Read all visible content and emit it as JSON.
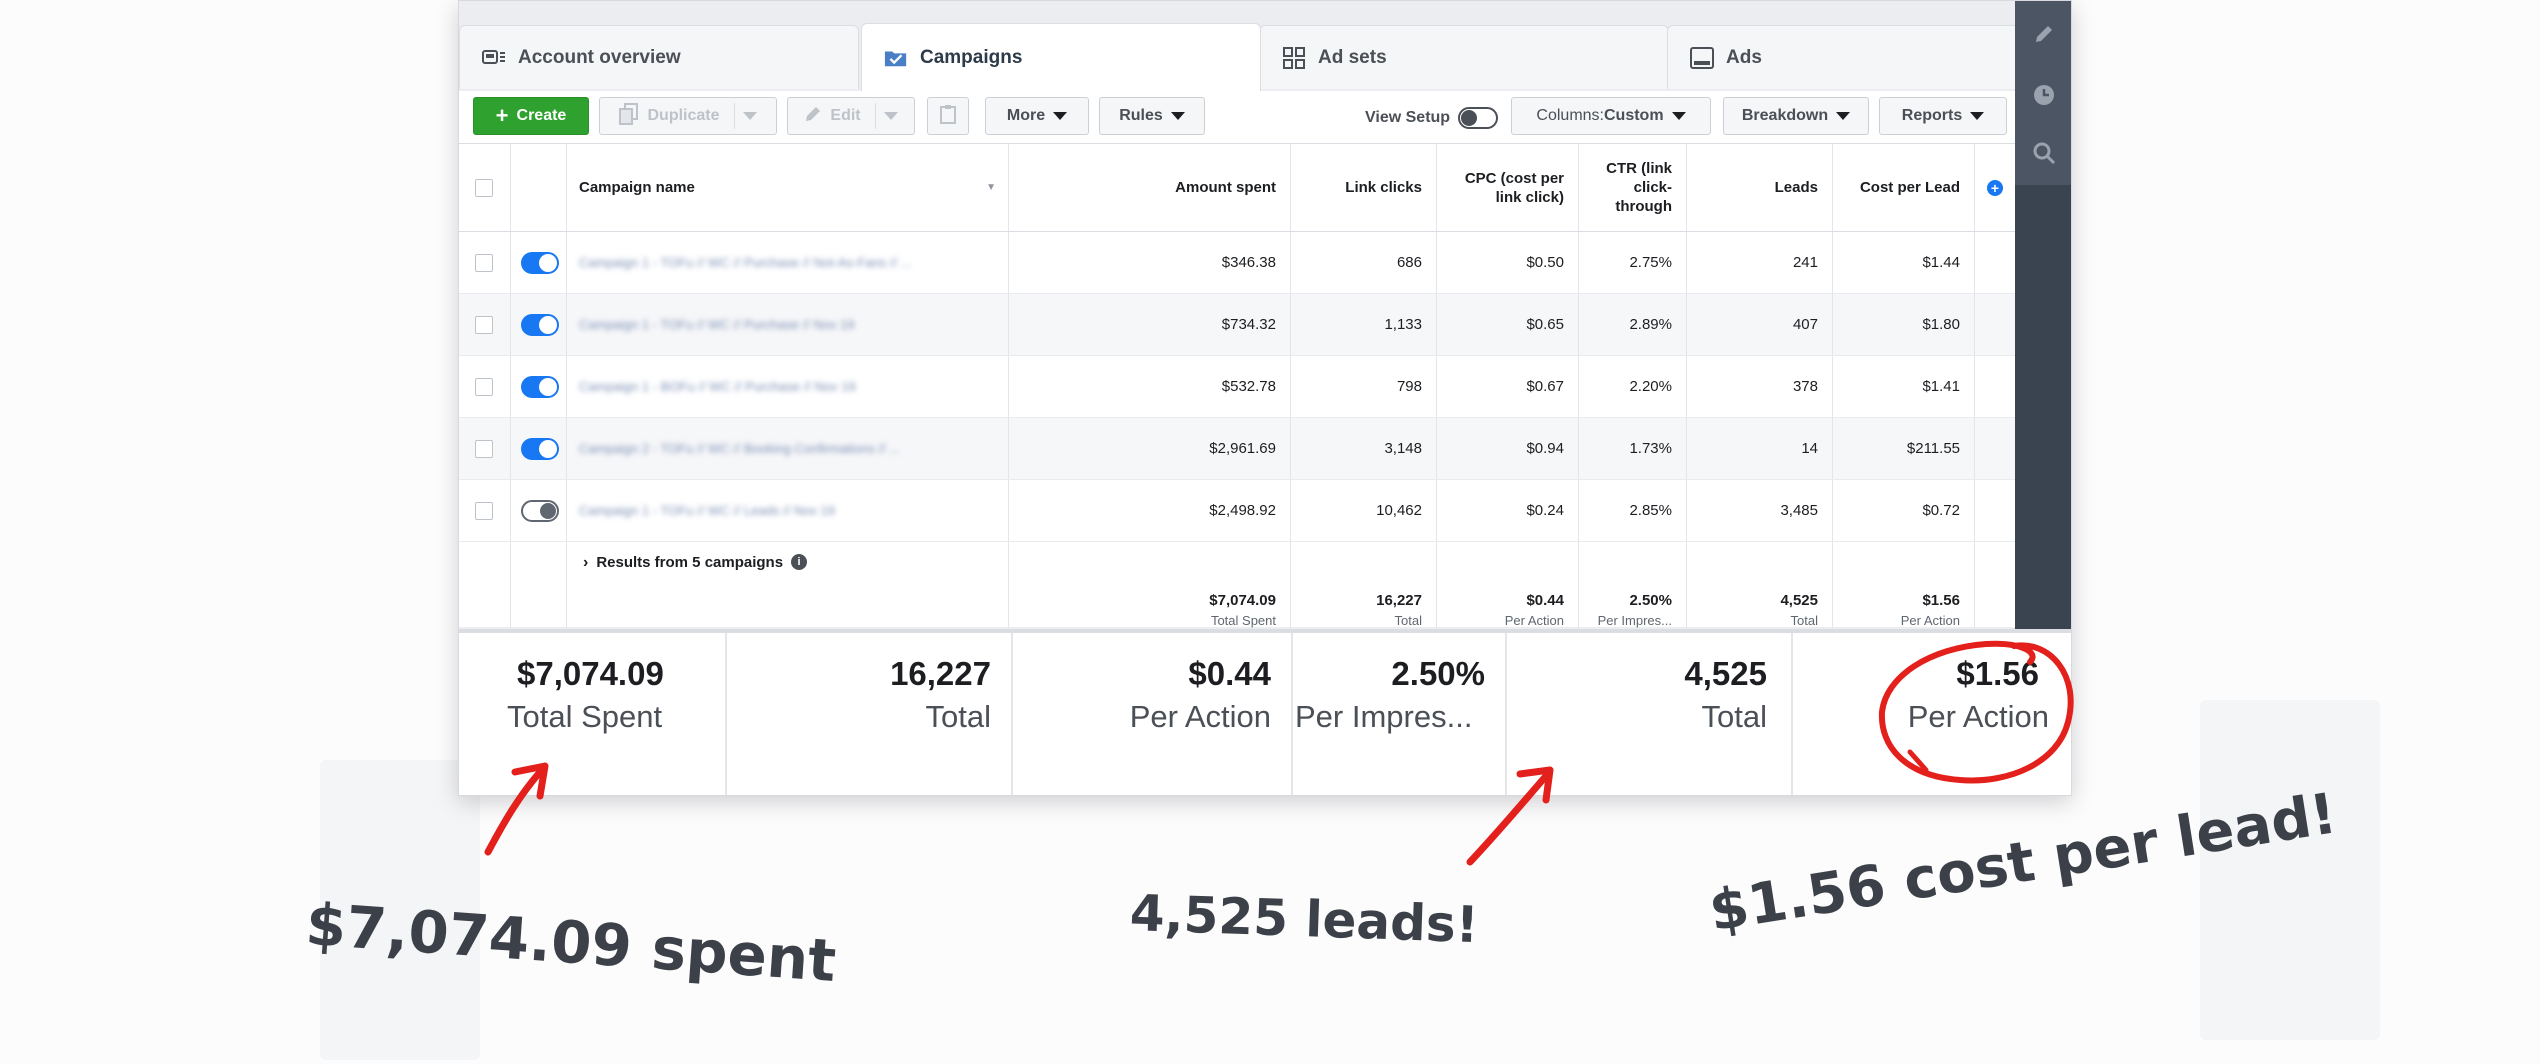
{
  "tabs": [
    {
      "label": "Account overview",
      "icon": "account-overview-icon"
    },
    {
      "label": "Campaigns",
      "icon": "folder-check-icon"
    },
    {
      "label": "Ad sets",
      "icon": "grid-icon"
    },
    {
      "label": "Ads",
      "icon": "ad-icon"
    }
  ],
  "toolbar": {
    "create": "Create",
    "duplicate": "Duplicate",
    "edit": "Edit",
    "more": "More",
    "rules": "Rules",
    "view_setup": "View Setup",
    "columns_prefix": "Columns: ",
    "columns_value": "Custom",
    "breakdown": "Breakdown",
    "reports": "Reports"
  },
  "table": {
    "headers": {
      "campaign_name": "Campaign name",
      "amount_spent": "Amount spent",
      "link_clicks": "Link clicks",
      "cpc": [
        "CPC (cost per",
        "link click)"
      ],
      "ctr": [
        "CTR (link",
        "click-",
        "through"
      ],
      "leads": "Leads",
      "cost_per_lead": "Cost per Lead"
    },
    "rows": [
      {
        "name": "Campaign 1 - TOFu // WC // Purchase // Not-As-Fans // ...",
        "active": true,
        "amount_spent": "$346.38",
        "link_clicks": "686",
        "cpc": "$0.50",
        "ctr": "2.75%",
        "leads": "241",
        "cost_per_lead": "$1.44"
      },
      {
        "name": "Campaign 1 - TOFu // WC // Purchase // Nov 19",
        "active": true,
        "amount_spent": "$734.32",
        "link_clicks": "1,133",
        "cpc": "$0.65",
        "ctr": "2.89%",
        "leads": "407",
        "cost_per_lead": "$1.80"
      },
      {
        "name": "Campaign 1 - BOFu // WC // Purchase // Nov 19",
        "active": true,
        "amount_spent": "$532.78",
        "link_clicks": "798",
        "cpc": "$0.67",
        "ctr": "2.20%",
        "leads": "378",
        "cost_per_lead": "$1.41"
      },
      {
        "name": "Campaign 2 - TOFu // WC // Booking Confirmations // ...",
        "active": true,
        "amount_spent": "$2,961.69",
        "link_clicks": "3,148",
        "cpc": "$0.94",
        "ctr": "1.73%",
        "leads": "14",
        "cost_per_lead": "$211.55"
      },
      {
        "name": "Campaign 1 - TOFu // WC // Leads // Nov 19",
        "active": false,
        "amount_spent": "$2,498.92",
        "link_clicks": "10,462",
        "cpc": "$0.24",
        "ctr": "2.85%",
        "leads": "3,485",
        "cost_per_lead": "$0.72"
      }
    ],
    "totals": {
      "label": "Results from 5 campaigns",
      "amount_spent": {
        "value": "$7,074.09",
        "sub": "Total Spent"
      },
      "link_clicks": {
        "value": "16,227",
        "sub": "Total"
      },
      "cpc": {
        "value": "$0.44",
        "sub": "Per Action"
      },
      "ctr": {
        "value": "2.50%",
        "sub": "Per Impres..."
      },
      "leads": {
        "value": "4,525",
        "sub": "Total"
      },
      "cost_per_lead": {
        "value": "$1.56",
        "sub": "Per Action"
      }
    }
  },
  "summary": [
    {
      "value": "$7,074.09",
      "sub": "Total Spent"
    },
    {
      "value": "16,227",
      "sub": "Total"
    },
    {
      "value": "$0.44",
      "sub": "Per Action"
    },
    {
      "value": "2.50%",
      "sub": "Per Impres..."
    },
    {
      "value": "4,525",
      "sub": "Total"
    },
    {
      "value": "$1.56",
      "sub": "Per Action"
    }
  ],
  "annotations": {
    "spent": "$7,074.09 spent",
    "leads": "4,525 leads!",
    "cost": "$1.56 cost per lead!"
  },
  "colors": {
    "accent_red": "#e3201b",
    "create_green": "#2ea12e",
    "toggle_blue": "#1877f2",
    "rail_dark": "#3a4350"
  },
  "rail_icons": [
    "pencil-icon",
    "clock-icon",
    "search-icon"
  ]
}
